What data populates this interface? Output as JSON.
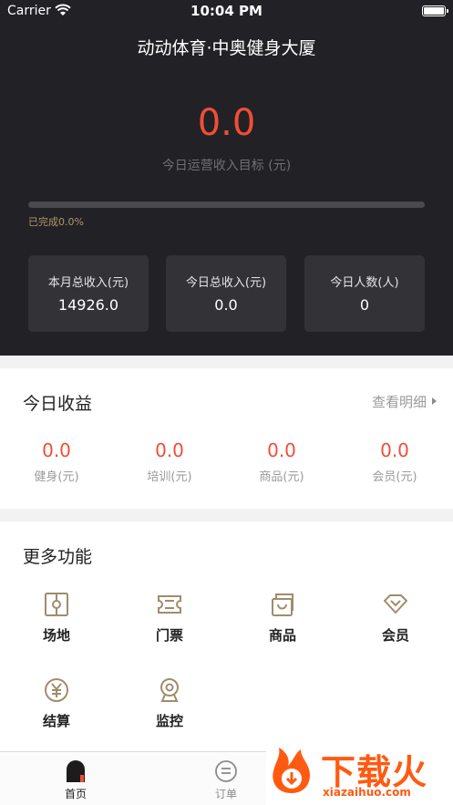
{
  "status_bar": {
    "carrier": "Carrier",
    "time": "10:04 PM"
  },
  "header": {
    "venue": "动动体育·中奥健身大厦",
    "target_value": "0.0",
    "target_label": "今日运营收入目标 (元)",
    "progress_text": "已完成0.0%",
    "progress_fraction": 0.0
  },
  "stats": [
    {
      "label": "本月总收入(元)",
      "value": "14926.0"
    },
    {
      "label": "今日总收入(元)",
      "value": "0.0"
    },
    {
      "label": "今日人数(人)",
      "value": "0"
    }
  ],
  "income": {
    "title": "今日收益",
    "detail_link": "查看明细",
    "items": [
      {
        "value": "0.0",
        "label": "健身(元)"
      },
      {
        "value": "0.0",
        "label": "培训(元)"
      },
      {
        "value": "0.0",
        "label": "商品(元)"
      },
      {
        "value": "0.0",
        "label": "会员(元)"
      }
    ]
  },
  "functions": {
    "title": "更多功能",
    "items": [
      {
        "label": "场地",
        "icon": "venue-icon"
      },
      {
        "label": "门票",
        "icon": "ticket-icon"
      },
      {
        "label": "商品",
        "icon": "product-icon"
      },
      {
        "label": "会员",
        "icon": "member-icon"
      },
      {
        "label": "结算",
        "icon": "settlement-icon"
      },
      {
        "label": "监控",
        "icon": "camera-icon"
      }
    ]
  },
  "tabs": [
    {
      "label": "首页",
      "icon": "home-icon",
      "active": true
    },
    {
      "label": "订单",
      "icon": "order-icon",
      "active": false
    }
  ],
  "watermark": {
    "text_cn": "下载火",
    "text_en": "xiazaihuo.com"
  },
  "colors": {
    "accent": "#f04e37",
    "gold": "#a08c6c",
    "dark": "#222226",
    "watermark": "#ff5a12"
  }
}
